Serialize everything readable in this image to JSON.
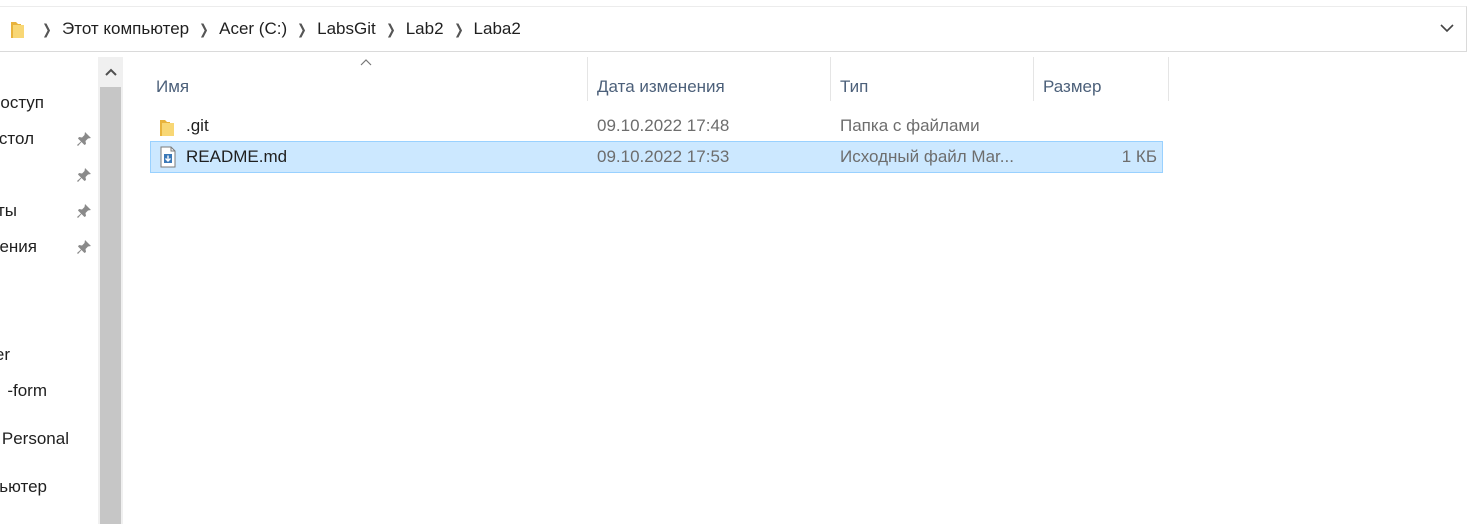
{
  "addressbar": {
    "crumbs": [
      {
        "label": "Этот компьютер"
      },
      {
        "label": "Acer (C:)"
      },
      {
        "label": "LabsGit"
      },
      {
        "label": "Lab2"
      },
      {
        "label": "Laba2"
      }
    ],
    "icons": {
      "folder": "folder-icon",
      "dropdown": "chevron-down-icon",
      "separator": "chevron-right-icon"
    }
  },
  "navpane": {
    "items": [
      {
        "label": "оступ",
        "pinned": false
      },
      {
        "label": "стол",
        "pinned": true
      },
      {
        "label": "",
        "pinned": true
      },
      {
        "label": "ты",
        "pinned": true
      },
      {
        "label": "ения",
        "pinned": true
      },
      {
        "label": "er",
        "pinned": false
      },
      {
        "label": "-form",
        "pinned": false
      },
      {
        "label": "Personal",
        "pinned": false
      },
      {
        "label": "ьютер",
        "pinned": false
      }
    ]
  },
  "filelist": {
    "columns": {
      "name": "Имя",
      "date": "Дата изменения",
      "type": "Тип",
      "size": "Размер"
    },
    "sort_column": "name",
    "rows": [
      {
        "name": ".git",
        "date": "09.10.2022 17:48",
        "type": "Папка с файлами",
        "size": "",
        "icon": "folder-icon",
        "selected": false
      },
      {
        "name": "README.md",
        "date": "09.10.2022 17:53",
        "type": "Исходный файл Mar...",
        "size": "1 КБ",
        "icon": "markdown-file-icon",
        "selected": true
      }
    ]
  },
  "colors": {
    "selection_bg": "#cce8ff",
    "selection_border": "#99d1ff",
    "header_text": "#4c607a",
    "scrollbar_thumb": "#c6c6c6"
  }
}
